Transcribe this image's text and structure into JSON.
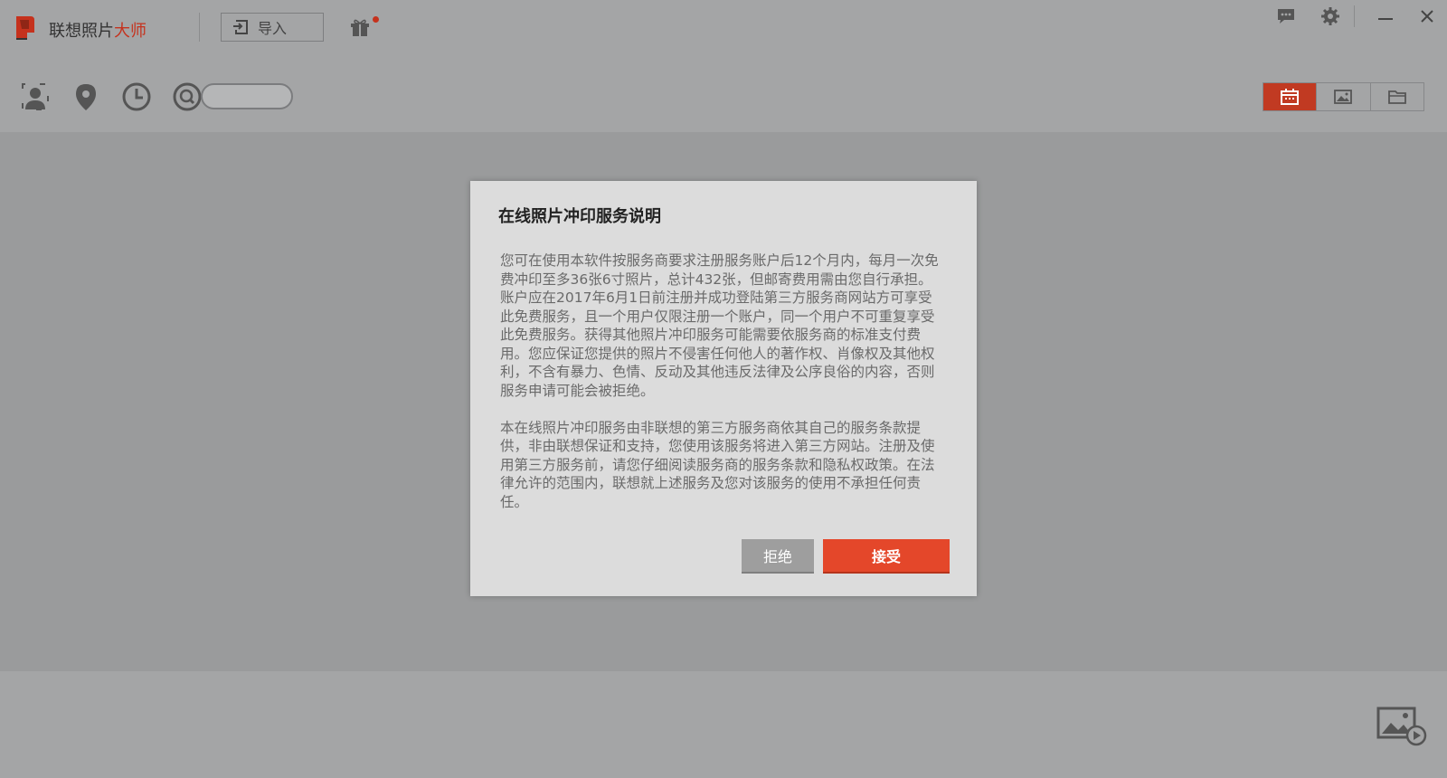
{
  "titlebar": {
    "app_name_main": "联想照片",
    "app_name_accent": "大师",
    "import_label": "导入",
    "accent_color": "#c5321d"
  },
  "toolbar": {
    "tools": [
      "person-icon",
      "location-pin-icon",
      "clock-icon",
      "search-icon"
    ],
    "search_placeholder": "",
    "views": [
      "calendar-view-icon",
      "image-view-icon",
      "folder-view-icon"
    ],
    "active_view": "calendar-view-icon"
  },
  "window_controls": [
    "feedback-icon",
    "settings-gear-icon",
    "minimize-icon",
    "close-icon"
  ],
  "dialog": {
    "title": "在线照片冲印服务说明",
    "paragraph1": "您可在使用本软件按服务商要求注册服务账户后12个月内，每月一次免费冲印至多36张6寸照片，总计432张，但邮寄费用需由您自行承担。账户应在2017年6月1日前注册并成功登陆第三方服务商网站方可享受此免费服务，且一个用户仅限注册一个账户，同一个用户不可重复享受此免费服务。获得其他照片冲印服务可能需要依服务商的标准支付费用。您应保证您提供的照片不侵害任何他人的著作权、肖像权及其他权利，不含有暴力、色情、反动及其他违反法律及公序良俗的内容，否则服务申请可能会被拒绝。",
    "paragraph2": "本在线照片冲印服务由非联想的第三方服务商依其自己的服务条款提供，非由联想保证和支持，您使用该服务将进入第三方网站。注册及使用第三方服务前，请您仔细阅读服务商的服务条款和隐私权政策。在法律允许的范围内，联想就上述服务及您对该服务的使用不承担任何责任。",
    "reject_label": "拒绝",
    "accept_label": "接受",
    "accept_color": "#e4472a"
  }
}
